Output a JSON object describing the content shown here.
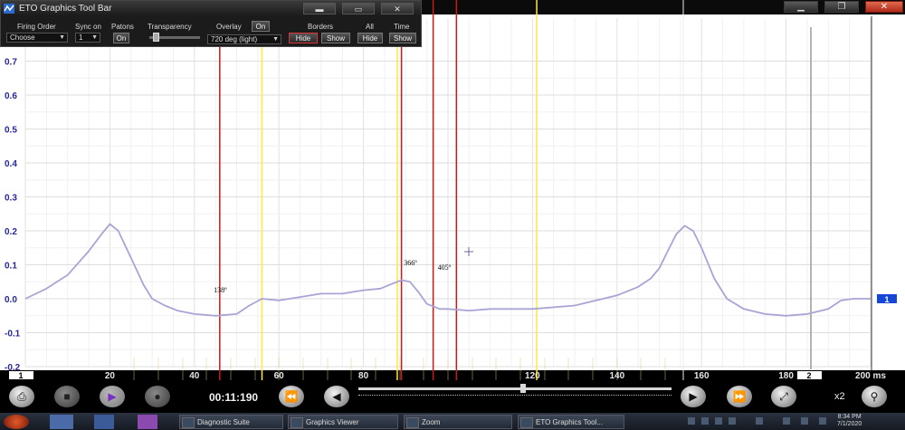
{
  "toolbar": {
    "title": "ETO Graphics Tool Bar",
    "firing_order_label": "Firing Order",
    "firing_order_value": "Choose",
    "sync_label": "Sync on",
    "sync_value": "1",
    "patons_label": "Patons",
    "patons_btn": "On",
    "transparency_label": "Transparency",
    "overlay_label": "Overlay",
    "overlay_btn": "On",
    "overlay_value": "720 deg (light)",
    "borders_label": "Borders",
    "borders_hide": "Hide",
    "borders_show": "Show",
    "all_label": "All",
    "all_hide": "Hide",
    "time_label": "Time",
    "time_show": "Show"
  },
  "plot": {
    "cursor_left_label": "1",
    "cursor_right_label": "2",
    "channel_badge": "1",
    "channel_badge_color": "#1446d8",
    "trace_color": "#a8a4d6",
    "annotations": [
      {
        "text": "138º",
        "x_ms": 45
      },
      {
        "text": "366º",
        "x_ms": 90
      },
      {
        "text": "405º",
        "x_ms": 98
      }
    ]
  },
  "chart_data": {
    "type": "line",
    "xlabel": "",
    "ylabel": "",
    "xlim": [
      0,
      200
    ],
    "ylim": [
      -0.2,
      0.8
    ],
    "x_unit": "ms",
    "x_ticks": [
      20,
      40,
      60,
      80,
      100,
      120,
      140,
      160,
      180,
      200
    ],
    "x_tick_labels": [
      "20",
      "40",
      "60",
      "80",
      "",
      "120",
      "140",
      "160",
      "180",
      "200 ms"
    ],
    "y_ticks": [
      0.7,
      0.6,
      0.5,
      0.4,
      0.3,
      0.2,
      0.1,
      0.0,
      -0.1,
      -0.2
    ],
    "y_tick_labels": [
      "0.7",
      "0.6",
      "0.5",
      "0.4",
      "0.3",
      "0.2",
      "0.1",
      "0.0",
      "-0.1",
      "-0.2"
    ],
    "grid": true,
    "series": [
      {
        "x": [
          0,
          5,
          10,
          15,
          18,
          20,
          22,
          25,
          28,
          30,
          33,
          36,
          40,
          45,
          50,
          53,
          56,
          60,
          65,
          70,
          75,
          80,
          84,
          87,
          89,
          91,
          93,
          95,
          98,
          100,
          105,
          110,
          120,
          130,
          135,
          140,
          145,
          148,
          150,
          152,
          154,
          156,
          158,
          160,
          163,
          166,
          170,
          175,
          180,
          185,
          190,
          193,
          196,
          200
        ],
        "y": [
          0.0,
          0.03,
          0.07,
          0.14,
          0.19,
          0.22,
          0.2,
          0.12,
          0.04,
          0.0,
          -0.02,
          -0.035,
          -0.045,
          -0.05,
          -0.045,
          -0.02,
          0.0,
          -0.005,
          0.005,
          0.015,
          0.015,
          0.025,
          0.03,
          0.045,
          0.055,
          0.05,
          0.02,
          -0.015,
          -0.03,
          -0.03,
          -0.035,
          -0.03,
          -0.03,
          -0.02,
          -0.005,
          0.01,
          0.035,
          0.06,
          0.09,
          0.14,
          0.19,
          0.215,
          0.2,
          0.15,
          0.06,
          0.0,
          -0.03,
          -0.045,
          -0.05,
          -0.045,
          -0.03,
          -0.005,
          0.0,
          0.0
        ]
      }
    ]
  },
  "controls": {
    "time_display": "00:11:190",
    "zoom_label": "x2"
  },
  "taskbar": {
    "items": [
      {
        "label": "Diagnostic Suite",
        "x": 198,
        "w": 115
      },
      {
        "label": "Graphics Viewer",
        "x": 318,
        "w": 122
      },
      {
        "label": "Zoom",
        "x": 446,
        "w": 120
      },
      {
        "label": "ETO Graphics Tool...",
        "x": 572,
        "w": 118
      }
    ],
    "clock_time": "8:34 PM",
    "clock_date": "7/1/2020"
  }
}
